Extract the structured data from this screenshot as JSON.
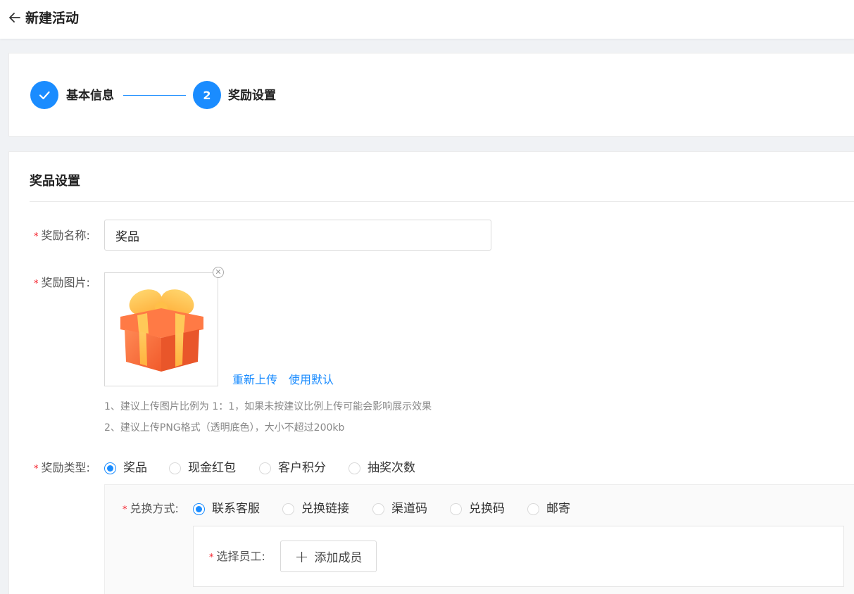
{
  "header": {
    "title": "新建活动"
  },
  "steps": [
    {
      "label": "基本信息",
      "state": "done"
    },
    {
      "label": "奖励设置",
      "number": "2",
      "state": "active"
    }
  ],
  "section": {
    "title": "奖品设置"
  },
  "form": {
    "reward_name": {
      "label": "奖励名称:",
      "value": "奖品"
    },
    "reward_image": {
      "label": "奖励图片:",
      "reupload": "重新上传",
      "use_default": "使用默认",
      "hints": [
        "1、建议上传图片比例为 1：1，如果未按建议比例上传可能会影响展示效果",
        "2、建议上传PNG格式（透明底色），大小不超过200kb"
      ]
    },
    "reward_type": {
      "label": "奖励类型:",
      "options": [
        "奖品",
        "现金红包",
        "客户积分",
        "抽奖次数"
      ],
      "selected": 0
    },
    "redeem_method": {
      "label": "兑换方式:",
      "options": [
        "联系客服",
        "兑换链接",
        "渠道码",
        "兑换码",
        "邮寄"
      ],
      "selected": 0
    },
    "select_staff": {
      "label": "选择员工:",
      "button": "添加成员"
    }
  },
  "colors": {
    "accent": "#1a8cff",
    "required": "#f5222d",
    "background": "#f0f2f5"
  },
  "icons": [
    "back-arrow-icon",
    "check-icon",
    "close-icon",
    "gift-icon",
    "plus-icon"
  ]
}
